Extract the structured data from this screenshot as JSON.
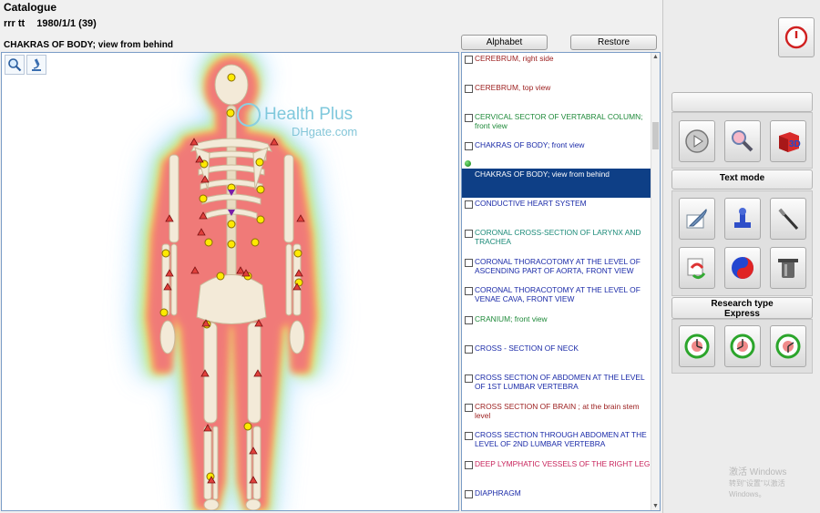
{
  "header": {
    "title": "Catalogue",
    "user_name": "rrr  tt",
    "user_date": "1980/1/1 (39)",
    "view_title": "CHAKRAS OF BODY; view from behind"
  },
  "buttons": {
    "alphabet": "Alphabet",
    "restore": "Restore"
  },
  "watermark": {
    "line1": "Health Plus",
    "line2": "DHgate.com"
  },
  "list": {
    "items": [
      {
        "label": "CEREBRUM, right side",
        "color": "#9b1c1c"
      },
      {
        "label": "CEREBRUM, top view",
        "color": "#9b1c1c"
      },
      {
        "label": "CERVICAL  SECTOR  OF  VERTABRAL  COLUMN; front view",
        "color": "#1f8a3a"
      },
      {
        "label": "CHAKRAS OF BODY; front view",
        "color": "#1a2aa8"
      },
      {
        "label": "CHAKRAS OF BODY; view from behind",
        "color": "#ffffff",
        "selected": true
      },
      {
        "label": "CONDUCTIVE HEART SYSTEM",
        "color": "#1a2aa8"
      },
      {
        "label": "CORONAL CROSS-SECTION OF LARYNX AND TRACHEA",
        "color": "#1a8a78"
      },
      {
        "label": "CORONAL THORACOTOMY AT THE LEVEL OF ASCENDING PART OF AORTA, FRONT VIEW",
        "color": "#1a2aa8"
      },
      {
        "label": "CORONAL THORACOTOMY AT THE LEVEL OF VENAE CAVA, FRONT VIEW",
        "color": "#1a2aa8"
      },
      {
        "label": "CRANIUM; front view",
        "color": "#1f8a3a"
      },
      {
        "label": "CROSS - SECTION OF NECK",
        "color": "#1a2aa8"
      },
      {
        "label": "CROSS SECTION OF ABDOMEN AT THE LEVEL OF 1ST LUMBAR VERTEBRA",
        "color": "#1a2aa8"
      },
      {
        "label": "CROSS SECTION OF BRAIN ; at the brain stem level",
        "color": "#9b1c1c"
      },
      {
        "label": "CROSS SECTION THROUGH ABDOMEN AT THE LEVEL OF 2ND LUMBAR VERTEBRA",
        "color": "#1a2aa8"
      },
      {
        "label": "DEEP LYMPHATIC VESSELS OF THE RIGHT LEG",
        "color": "#c8245c"
      },
      {
        "label": "DIAPHRAGM",
        "color": "#1a2aa8"
      }
    ]
  },
  "right_panel": {
    "text_mode": "Text mode",
    "research_type": "Research type",
    "express": "Express"
  },
  "os_watermark": {
    "line1": "激活 Windows",
    "line2": "转到\"设置\"以激活 Windows。"
  }
}
